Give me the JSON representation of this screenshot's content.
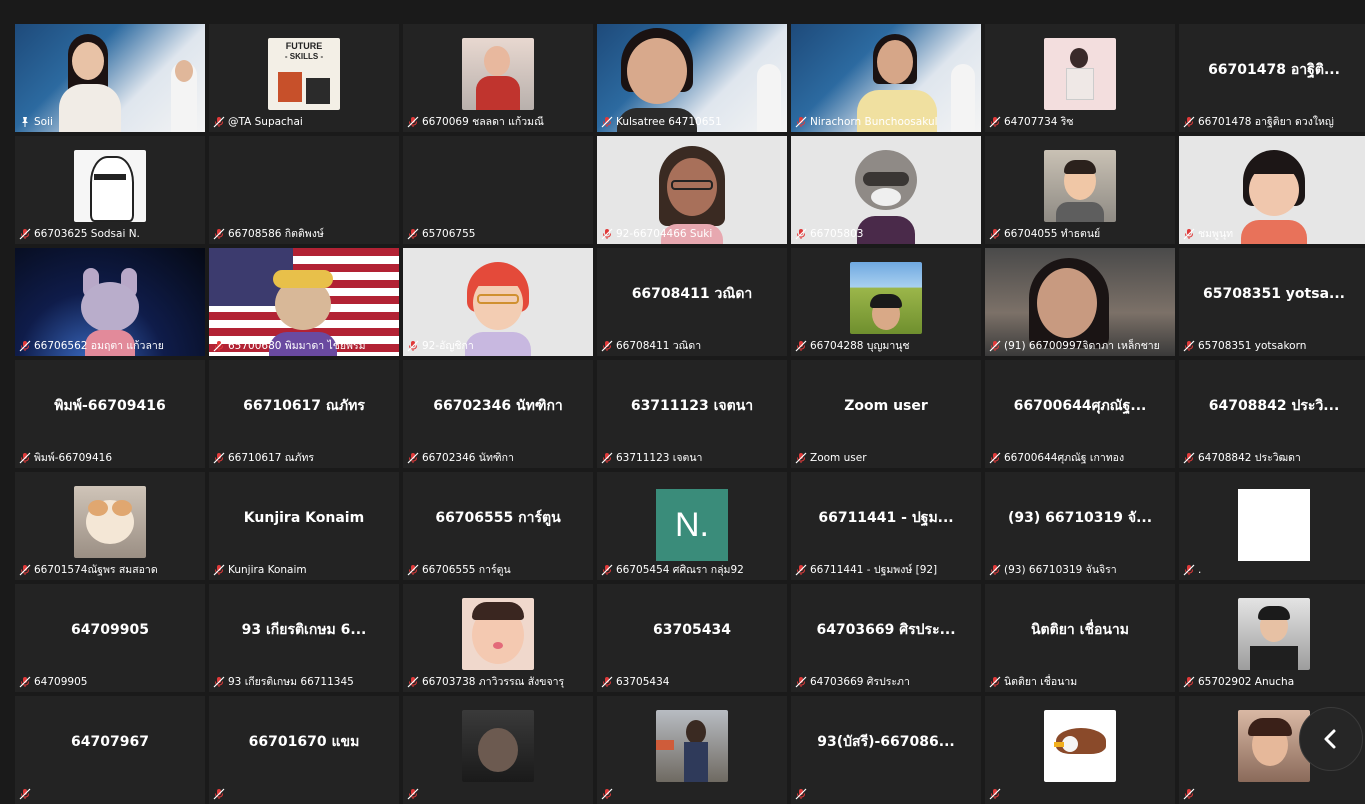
{
  "colors": {
    "background": "#1a1a1a",
    "tile": "#232323",
    "active_border": "#c8d46a",
    "mic_muted": "#e03a3a"
  },
  "tiles": [
    {
      "label": "Soii",
      "display": "video",
      "video": "spu-host",
      "active": true,
      "muted": false
    },
    {
      "label": "@TA Supachai",
      "display": "thumb",
      "thumb": "future-skills"
    },
    {
      "label": "6670069 ชลลดา แก้วมณี",
      "display": "thumb",
      "thumb": "person-red"
    },
    {
      "label": "Kulsatree 64710651",
      "display": "video",
      "video": "spu-girl"
    },
    {
      "label": "Nirachorn Bunchoosakul",
      "display": "video",
      "video": "spu-woman"
    },
    {
      "label": "64707734 ริซ",
      "display": "thumb",
      "thumb": "person-pink"
    },
    {
      "label": "66701478 อาฐิติยา ดวงใหญ่",
      "display": "name",
      "name": "66701478 อาฐิติ..."
    },
    {
      "label": "66703625 Sodsai N.",
      "display": "thumb",
      "thumb": "manga"
    },
    {
      "label": "66708586 กิตติพงษ์",
      "display": "blank"
    },
    {
      "label": "65706755",
      "display": "blank"
    },
    {
      "label": "92-66704466 Suki",
      "display": "video",
      "video": "avatar-girl-glasses"
    },
    {
      "label": "66705803",
      "display": "video",
      "video": "avatar-raccoon"
    },
    {
      "label": "66704055 ทำธตนย์",
      "display": "thumb",
      "thumb": "avatar-boy"
    },
    {
      "label": "ชมพูนุท",
      "display": "video",
      "video": "avatar-girl-bangs"
    },
    {
      "label": "66706562 อมฤตา แก้วลาย",
      "display": "video",
      "video": "space-bunny"
    },
    {
      "label": "65700680 พิมมาดา ไชยพรม",
      "display": "video",
      "video": "flag-avatar"
    },
    {
      "label": "92-อัญชิกา",
      "display": "video",
      "video": "avatar-redhair"
    },
    {
      "label": "66708411 วณิดา",
      "display": "name",
      "name": "66708411 วณิดา"
    },
    {
      "label": "66704288 บุญมานุช",
      "display": "thumb",
      "thumb": "field-girl"
    },
    {
      "label": "(91) 66700997จิดาภา เหล็กชาย",
      "display": "video",
      "video": "room-girl"
    },
    {
      "label": "65708351 yotsakorn",
      "display": "name",
      "name": "65708351 yotsa..."
    },
    {
      "label": "พิมพ์-66709416",
      "display": "name",
      "name": "พิมพ์-66709416"
    },
    {
      "label": "66710617 ณภัทร",
      "display": "name",
      "name": "66710617 ณภัทร"
    },
    {
      "label": "66702346 นัทฑิกา",
      "display": "name",
      "name": "66702346 นัทฑิกา"
    },
    {
      "label": "63711123 เจตนา",
      "display": "name",
      "name": "63711123 เจตนา"
    },
    {
      "label": "Zoom user",
      "display": "name",
      "name": "Zoom user"
    },
    {
      "label": "66700644ศุภณัฐ เกาทอง",
      "display": "name",
      "name": "66700644ศุภณัฐ..."
    },
    {
      "label": "64708842 ประวิฒดา",
      "display": "name",
      "name": "64708842 ประวิ..."
    },
    {
      "label": "66701574ณัฐพร สมสอาด",
      "display": "thumb",
      "thumb": "cat"
    },
    {
      "label": "Kunjira Konaim",
      "display": "name",
      "name": "Kunjira Konaim"
    },
    {
      "label": "66706555 การ์ตูน",
      "display": "name",
      "name": "66706555 การ์ตูน"
    },
    {
      "label": "66705454 ศศิณรา กลุ่ม92",
      "display": "letter",
      "letter": "N."
    },
    {
      "label": "66711441 - ปฐมพงษ์ [92]",
      "display": "name",
      "name": "66711441 - ปฐม..."
    },
    {
      "label": "(93) 66710319 จันจิรา",
      "display": "name",
      "name": "(93) 66710319 จั..."
    },
    {
      "label": ".",
      "display": "white"
    },
    {
      "label": "64709905",
      "display": "name",
      "name": "64709905"
    },
    {
      "label": "93 เกียรติเกษม 66711345",
      "display": "name",
      "name": "93 เกียรติเกษม 6..."
    },
    {
      "label": "66703738 ภาวิวรรณ สังขจารุ",
      "display": "thumb",
      "thumb": "child"
    },
    {
      "label": "63705434",
      "display": "name",
      "name": "63705434"
    },
    {
      "label": "64703669 ศิรประภา",
      "display": "name",
      "name": "64703669 ศิรประ..."
    },
    {
      "label": "นิตติยา เชื่อนาม",
      "display": "name",
      "name": "นิตติยา เชื่อนาม"
    },
    {
      "label": "65702902 Anucha",
      "display": "thumb",
      "thumb": "boy-hands"
    },
    {
      "label": "",
      "display": "name",
      "name": "64707967"
    },
    {
      "label": "",
      "display": "name",
      "name": "66701670 แขม"
    },
    {
      "label": "",
      "display": "thumb",
      "thumb": "dark-face"
    },
    {
      "label": "",
      "display": "thumb",
      "thumb": "street-girl"
    },
    {
      "label": "",
      "display": "name",
      "name": "93(บัสรี)-667086..."
    },
    {
      "label": "",
      "display": "thumb",
      "thumb": "eagle"
    },
    {
      "label": "",
      "display": "thumb",
      "thumb": "girl-hand"
    }
  ],
  "nav": {
    "icon": "chevron-left-icon"
  }
}
